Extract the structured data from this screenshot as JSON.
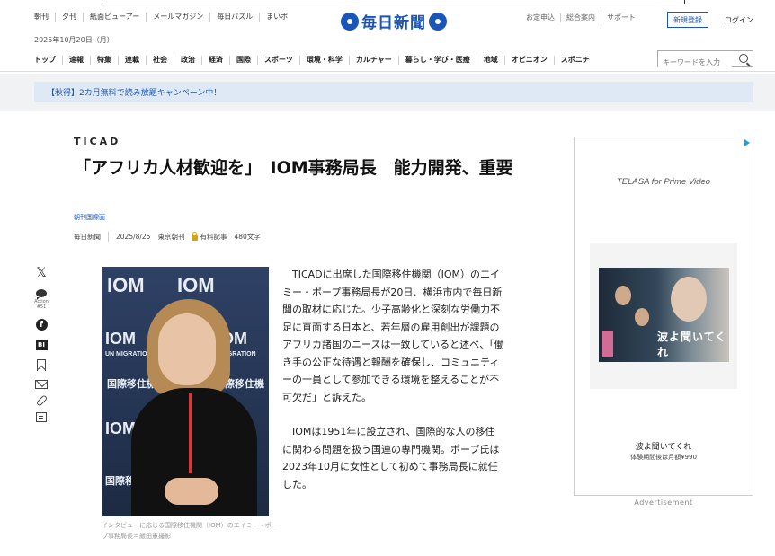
{
  "header": {
    "util_links": [
      "朝刊",
      "夕刊",
      "紙面ビューアー",
      "メールマガジン",
      "毎日パズル",
      "まいボ"
    ],
    "date": "2025年10月20日（月）",
    "logo_text": "毎日新聞",
    "right_links": [
      "お定申込",
      "総合案内",
      "サポート"
    ],
    "register_label": "新規登録",
    "login_label": "ログイン"
  },
  "nav": {
    "items": [
      "トップ",
      "速報",
      "特集",
      "連載",
      "社会",
      "政治",
      "経済",
      "国際",
      "スポーツ",
      "環境・科学",
      "カルチャー",
      "暮らし・学び・医療",
      "地域",
      "オピニオン",
      "スポニチ"
    ],
    "search_placeholder": "キーワードを入力"
  },
  "promo": {
    "text": "【秋得】2カ月無料で読み放題キャンペーン中！"
  },
  "article": {
    "kicker": "TICAD",
    "headline": "「アフリカ人材歓迎を」　IOM事務局長　能力開発、重要",
    "section": "朝刊国際面",
    "publisher": "毎日新聞",
    "date": "2025/8/25",
    "edition": "東京朝刊",
    "paid_label": "有料記事",
    "char_count": "480文字",
    "photo_caption": "インタビューに応じる国際移住機関（IOM）のエイミー・ポープ事務局長＝飯田憲撮影",
    "paragraphs": [
      "TICADに出席した国際移住機関（IOM）のエイミー・ポープ事務局長が20日、横浜市内で毎日新聞の取材に応じた。少子高齢化と深刻な労働力不足に直面する日本と、若年層の雇用創出が課題のアフリカ諸国のニーズは一致していると述べ、「働き手の公正な待遇と報酬を確保し、コミュニティーの一員として参加できる環境を整えることが不可欠だ」と訴えた。",
      "IOMは1951年に設立され、国際的な人の移住に関わる問題を扱う国連の専門機関。ポープ氏は2023年10月に女性として初めて事務局長に就任した。"
    ],
    "photo_wall_text": [
      "IOM",
      "UN MIGRATION",
      "国際移住機関"
    ]
  },
  "share": {
    "x_icon": "𝕏",
    "comment_label": "Action #51",
    "facebook_icon": "f",
    "bi_icon": "BI"
  },
  "ad": {
    "brand": "TELASA for Prime Video",
    "poster_title": "波よ聞いてくれ",
    "title": "波よ聞いてくれ",
    "price": "体験期間後は月額¥990",
    "label": "Advertisement"
  },
  "colors": {
    "brand_blue": "#1a56b8",
    "promo_bg": "#dfe9f5",
    "paid_lock": "#d6a11a"
  }
}
